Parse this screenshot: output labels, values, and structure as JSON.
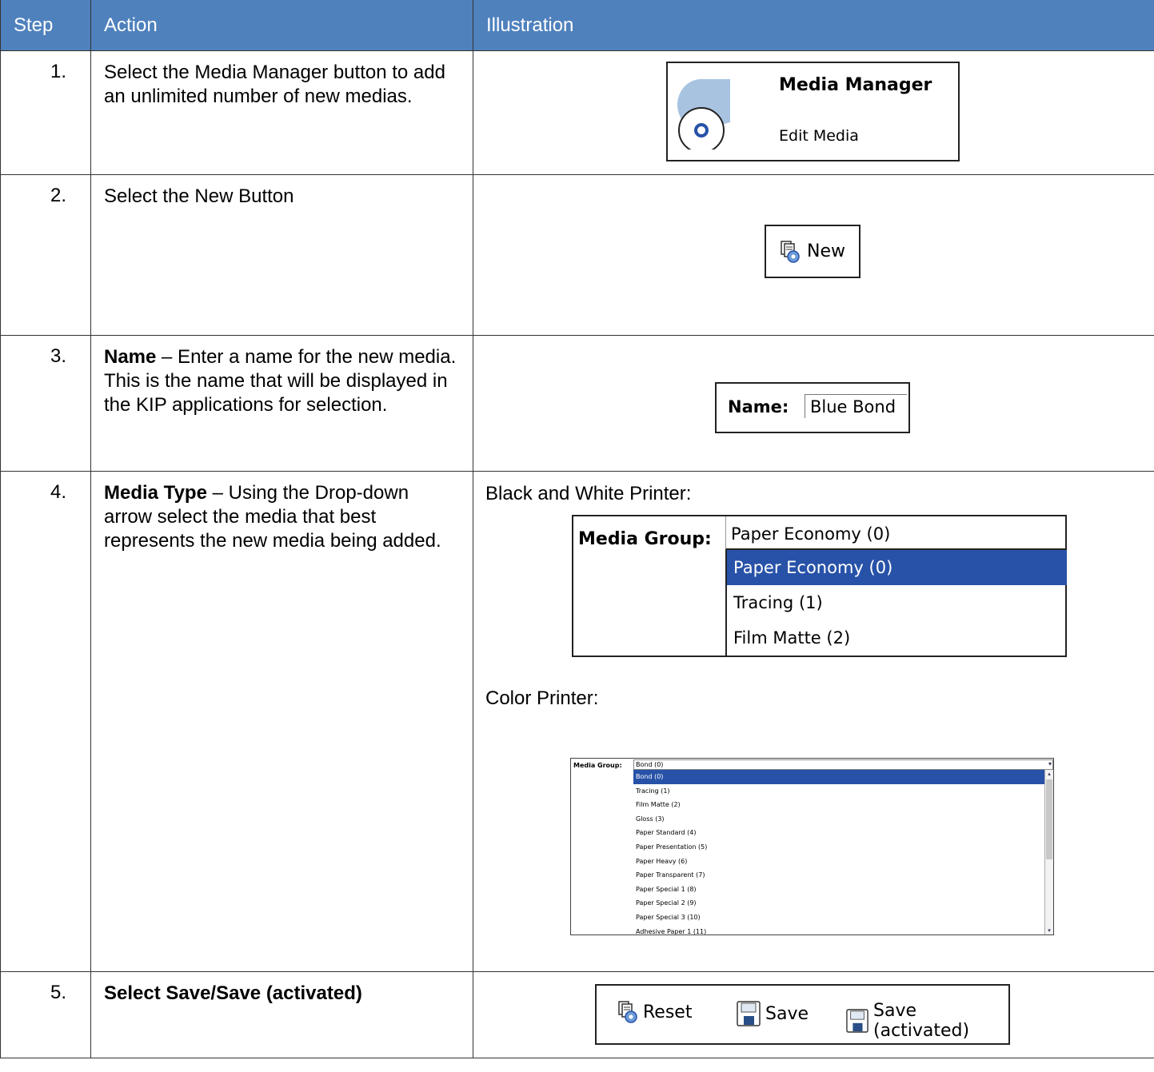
{
  "header": {
    "step": "Step",
    "action": "Action",
    "illustration": "Illustration"
  },
  "rows": [
    {
      "num": "1.",
      "action": "Select the Media Manager button to add an unlimited number of new medias."
    },
    {
      "num": "2.",
      "action": "Select the New Button"
    },
    {
      "num": "3.",
      "action_bold": "Name",
      "action": " – Enter a name for the new media. This is the name that will be displayed in the KIP applications for selection."
    },
    {
      "num": "4.",
      "action_bold": "Media Type",
      "action": " – Using the Drop-down arrow select the media that best represents the new media being added."
    },
    {
      "num": "5.",
      "action_bold": "Select Save/Save (activated)"
    }
  ],
  "media_manager": {
    "title": "Media Manager",
    "subtitle": "Edit Media",
    "icon": "media-roll-icon"
  },
  "new_button": {
    "label": "New",
    "icon": "new-document-icon"
  },
  "name_field": {
    "label": "Name:",
    "value": "Blue Bond"
  },
  "bw": {
    "heading": "Black and White Printer:",
    "label": "Media Group:",
    "selected": "Paper Economy (0)",
    "options": [
      "Paper Economy (0)",
      "Tracing (1)",
      "Film Matte (2)"
    ]
  },
  "color": {
    "heading": "Color Printer:",
    "label": "Media Group:",
    "selected": "Bond (0)",
    "options": [
      "Bond (0)",
      "Tracing (1)",
      "Film Matte (2)",
      "Gloss (3)",
      "Paper Standard (4)",
      "Paper Presentation (5)",
      "Paper Heavy (6)",
      "Paper Transparent (7)",
      "Paper Special 1 (8)",
      "Paper Special 2 (9)",
      "Paper Special 3 (10)",
      "Adhesive Paper 1 (11)"
    ]
  },
  "toolbar": {
    "reset": "Reset",
    "save": "Save",
    "save_activated": "Save (activated)"
  },
  "colors": {
    "header_bg": "#4f81bd",
    "selection": "#2752a8",
    "icon_blue": "#a8c3e0"
  }
}
